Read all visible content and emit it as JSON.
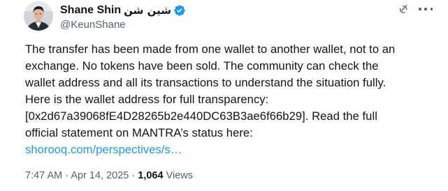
{
  "author": {
    "display_name": "Shane Shin",
    "display_name_arabic": "شين شن",
    "handle": "@KeunShane",
    "verified": true,
    "avatar_icon": "profile-photo"
  },
  "colors": {
    "text_primary": "#0f1419",
    "text_secondary": "#536471",
    "link": "#1d9bf0",
    "verified_badge": "#1d9bf0"
  },
  "tweet": {
    "lines": [
      "The transfer has been made from one wallet to another wallet, not to an",
      "exchange. No tokens have been sold. The community can check the",
      "wallet address and all its transactions to understand the situation fully.",
      "Here is the wallet address for full transparency:",
      "[0x2d67a39068fE4D28265b2e440DC63B3ae6f66b29]. Read the full",
      "official statement on MANTRA’s status here:"
    ],
    "link_text": "shorooq.com/perspectives/s…"
  },
  "meta": {
    "time": "7:47 AM",
    "separator": "·",
    "date": "Apr 14, 2025",
    "views_count": "1,064",
    "views_label": "Views"
  },
  "icons": {
    "grok": "grok-icon",
    "more": "more-options-icon",
    "verified": "verified-badge-icon"
  }
}
